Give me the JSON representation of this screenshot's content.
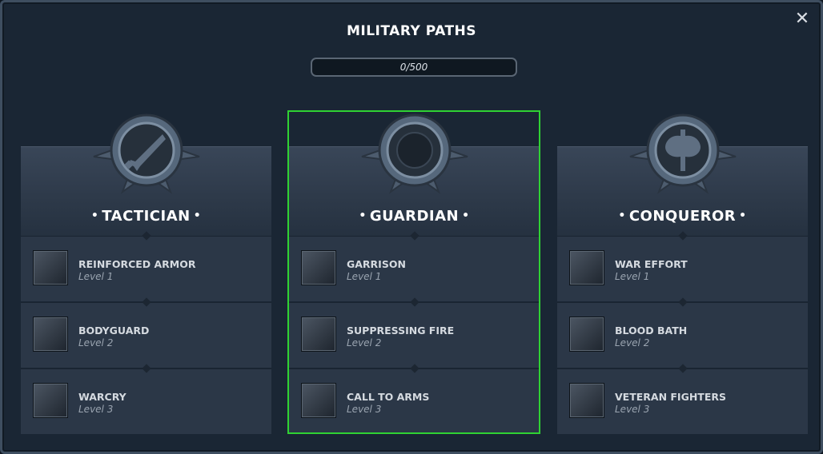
{
  "title": "MILITARY PATHS",
  "close_icon": "close-icon",
  "progress": {
    "text": "0/500",
    "current": 0,
    "max": 500
  },
  "colors": {
    "selected_border": "#2fd233",
    "panel": "#2b3747",
    "background": "#1a2634"
  },
  "paths": [
    {
      "name": "TACTICIAN",
      "emblem_icon": "sword-icon",
      "skills": [
        {
          "name": "REINFORCED ARMOR",
          "level": "Level 1",
          "icon": "armor-icon"
        },
        {
          "name": "BODYGUARD",
          "level": "Level 2",
          "icon": "bodyguard-icon"
        },
        {
          "name": "WARCRY",
          "level": "Level 3",
          "icon": "warcry-icon"
        }
      ]
    },
    {
      "name": "GUARDIAN",
      "emblem_icon": "shield-icon",
      "selected": true,
      "skills": [
        {
          "name": "GARRISON",
          "level": "Level 1",
          "icon": "tower-icon"
        },
        {
          "name": "SUPPRESSING FIRE",
          "level": "Level 2",
          "icon": "arrows-icon"
        },
        {
          "name": "CALL TO ARMS",
          "level": "Level 3",
          "icon": "horn-icon"
        }
      ]
    },
    {
      "name": "CONQUEROR",
      "emblem_icon": "axe-icon",
      "skills": [
        {
          "name": "WAR EFFORT",
          "level": "Level 1",
          "icon": "anvil-icon"
        },
        {
          "name": "BLOOD BATH",
          "level": "Level 2",
          "icon": "cleaver-icon"
        },
        {
          "name": "VETERAN FIGHTERS",
          "level": "Level 3",
          "icon": "helmet-icon"
        }
      ]
    }
  ]
}
